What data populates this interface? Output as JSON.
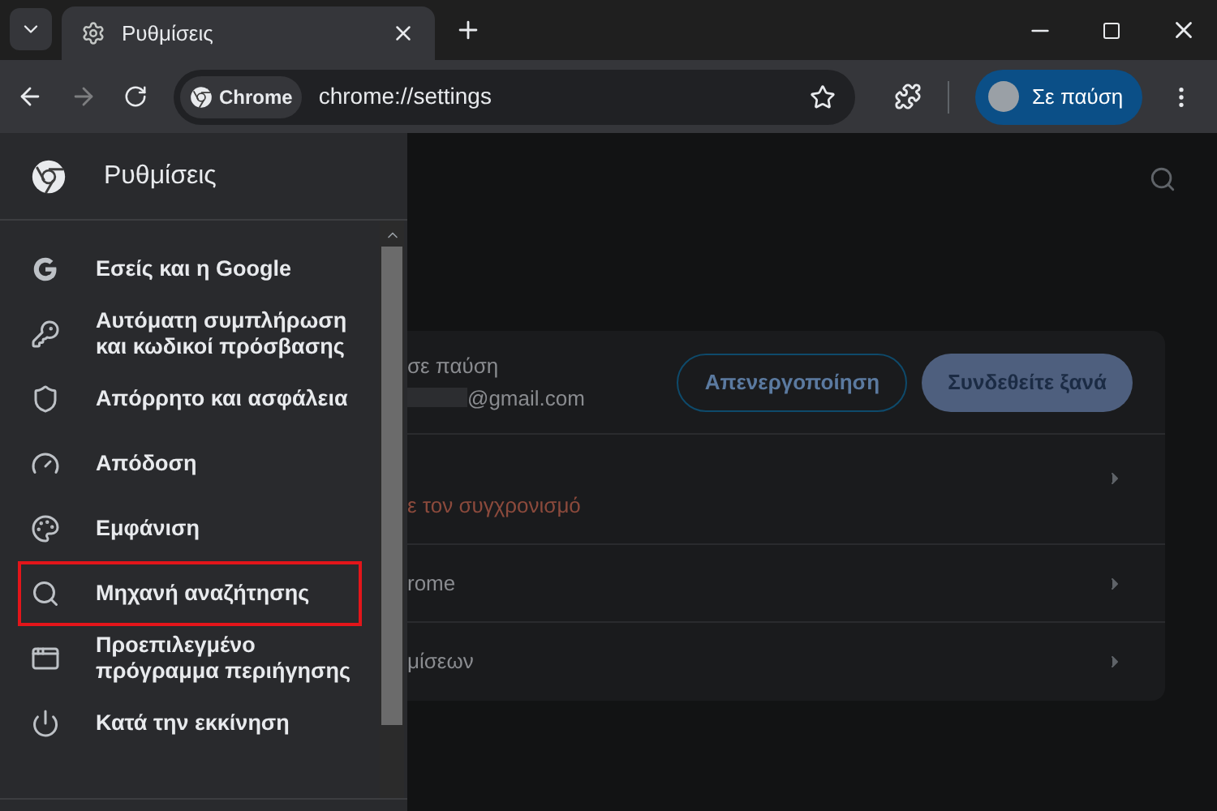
{
  "tab": {
    "title": "Ρυθμίσεις"
  },
  "toolbar": {
    "chip": "Chrome",
    "url": "chrome://settings",
    "profile": "Σε παύση"
  },
  "drawer": {
    "title": "Ρυθμίσεις",
    "items": [
      {
        "label": "Εσείς και η Google",
        "kind": "google",
        "highlighted": false
      },
      {
        "label": "Αυτόματη συμπλήρωση και κωδικοί πρόσβασης",
        "kind": "key",
        "highlighted": false
      },
      {
        "label": "Απόρρητο και ασφάλεια",
        "kind": "shield",
        "highlighted": false
      },
      {
        "label": "Απόδοση",
        "kind": "gauge",
        "highlighted": false
      },
      {
        "label": "Εμφάνιση",
        "kind": "palette",
        "highlighted": false
      },
      {
        "label": "Μηχανή αναζήτησης",
        "kind": "search",
        "highlighted": true
      },
      {
        "label": "Προεπιλεγμένο πρόγραμμα περιήγησης",
        "kind": "browser",
        "highlighted": false
      },
      {
        "label": "Κατά την εκκίνηση",
        "kind": "power",
        "highlighted": false
      }
    ]
  },
  "card": {
    "status": "σε παύση",
    "email": "@gmail.com",
    "buttons": [
      {
        "label": "Απενεργοποίηση",
        "kind": "outline"
      },
      {
        "label": "Συνδεθείτε ξανά",
        "kind": "filled"
      }
    ],
    "rows": [
      {
        "label": "ε τον συγχρονισμό",
        "warning": true
      },
      {
        "label": "rome",
        "warning": false
      },
      {
        "label": "μίσεων",
        "warning": false
      }
    ]
  }
}
